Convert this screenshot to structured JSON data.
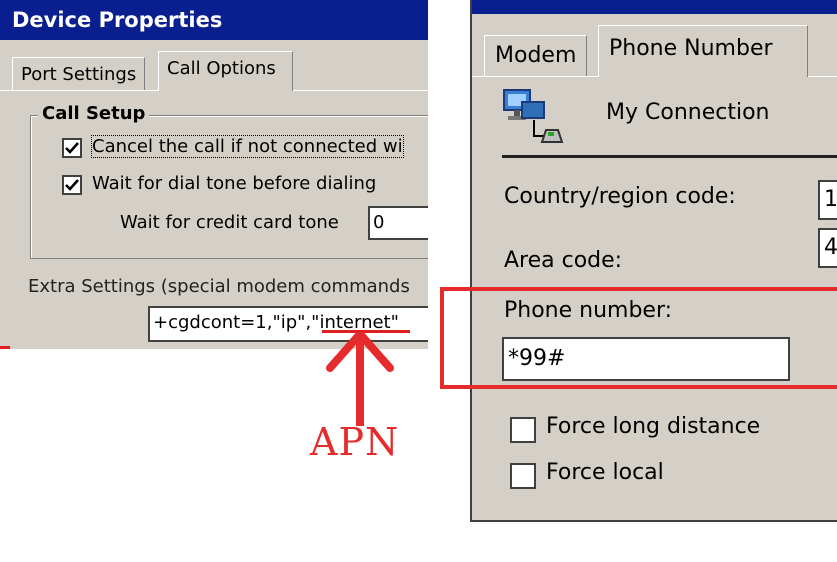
{
  "left_dialog": {
    "title": "Device Properties",
    "tabs": [
      "Port Settings",
      "Call Options"
    ],
    "active_tab": "Call Options",
    "group_title": "Call Setup",
    "cancel_call_label": "Cancel the call if not connected wi",
    "cancel_call_checked": true,
    "wait_dial_tone_label": "Wait for dial tone before dialing",
    "wait_dial_tone_checked": true,
    "credit_card_label": "Wait for credit card tone",
    "credit_card_value": "0",
    "extra_settings_label": "Extra Settings (special modem commands",
    "extra_settings_value": "+cgdcont=1,\"ip\",\"internet\""
  },
  "annotation": {
    "apn_label": "APN",
    "color": "#e52b2b"
  },
  "right_dialog": {
    "tabs": [
      "Modem",
      "Phone Number"
    ],
    "active_tab": "Phone Number",
    "connection_name": "My Connection",
    "country_label": "Country/region code:",
    "country_value": "1",
    "area_label": "Area code:",
    "area_value": "4",
    "phone_label": "Phone number:",
    "phone_value": "*99#",
    "force_long_distance_label": "Force long distance",
    "force_long_distance_checked": false,
    "force_local_label": "Force local",
    "force_local_checked": false
  },
  "colors": {
    "dialog_bg": "#d4d0c8",
    "titlebar": "#0a1f8f",
    "highlight": "#e52b2b"
  }
}
